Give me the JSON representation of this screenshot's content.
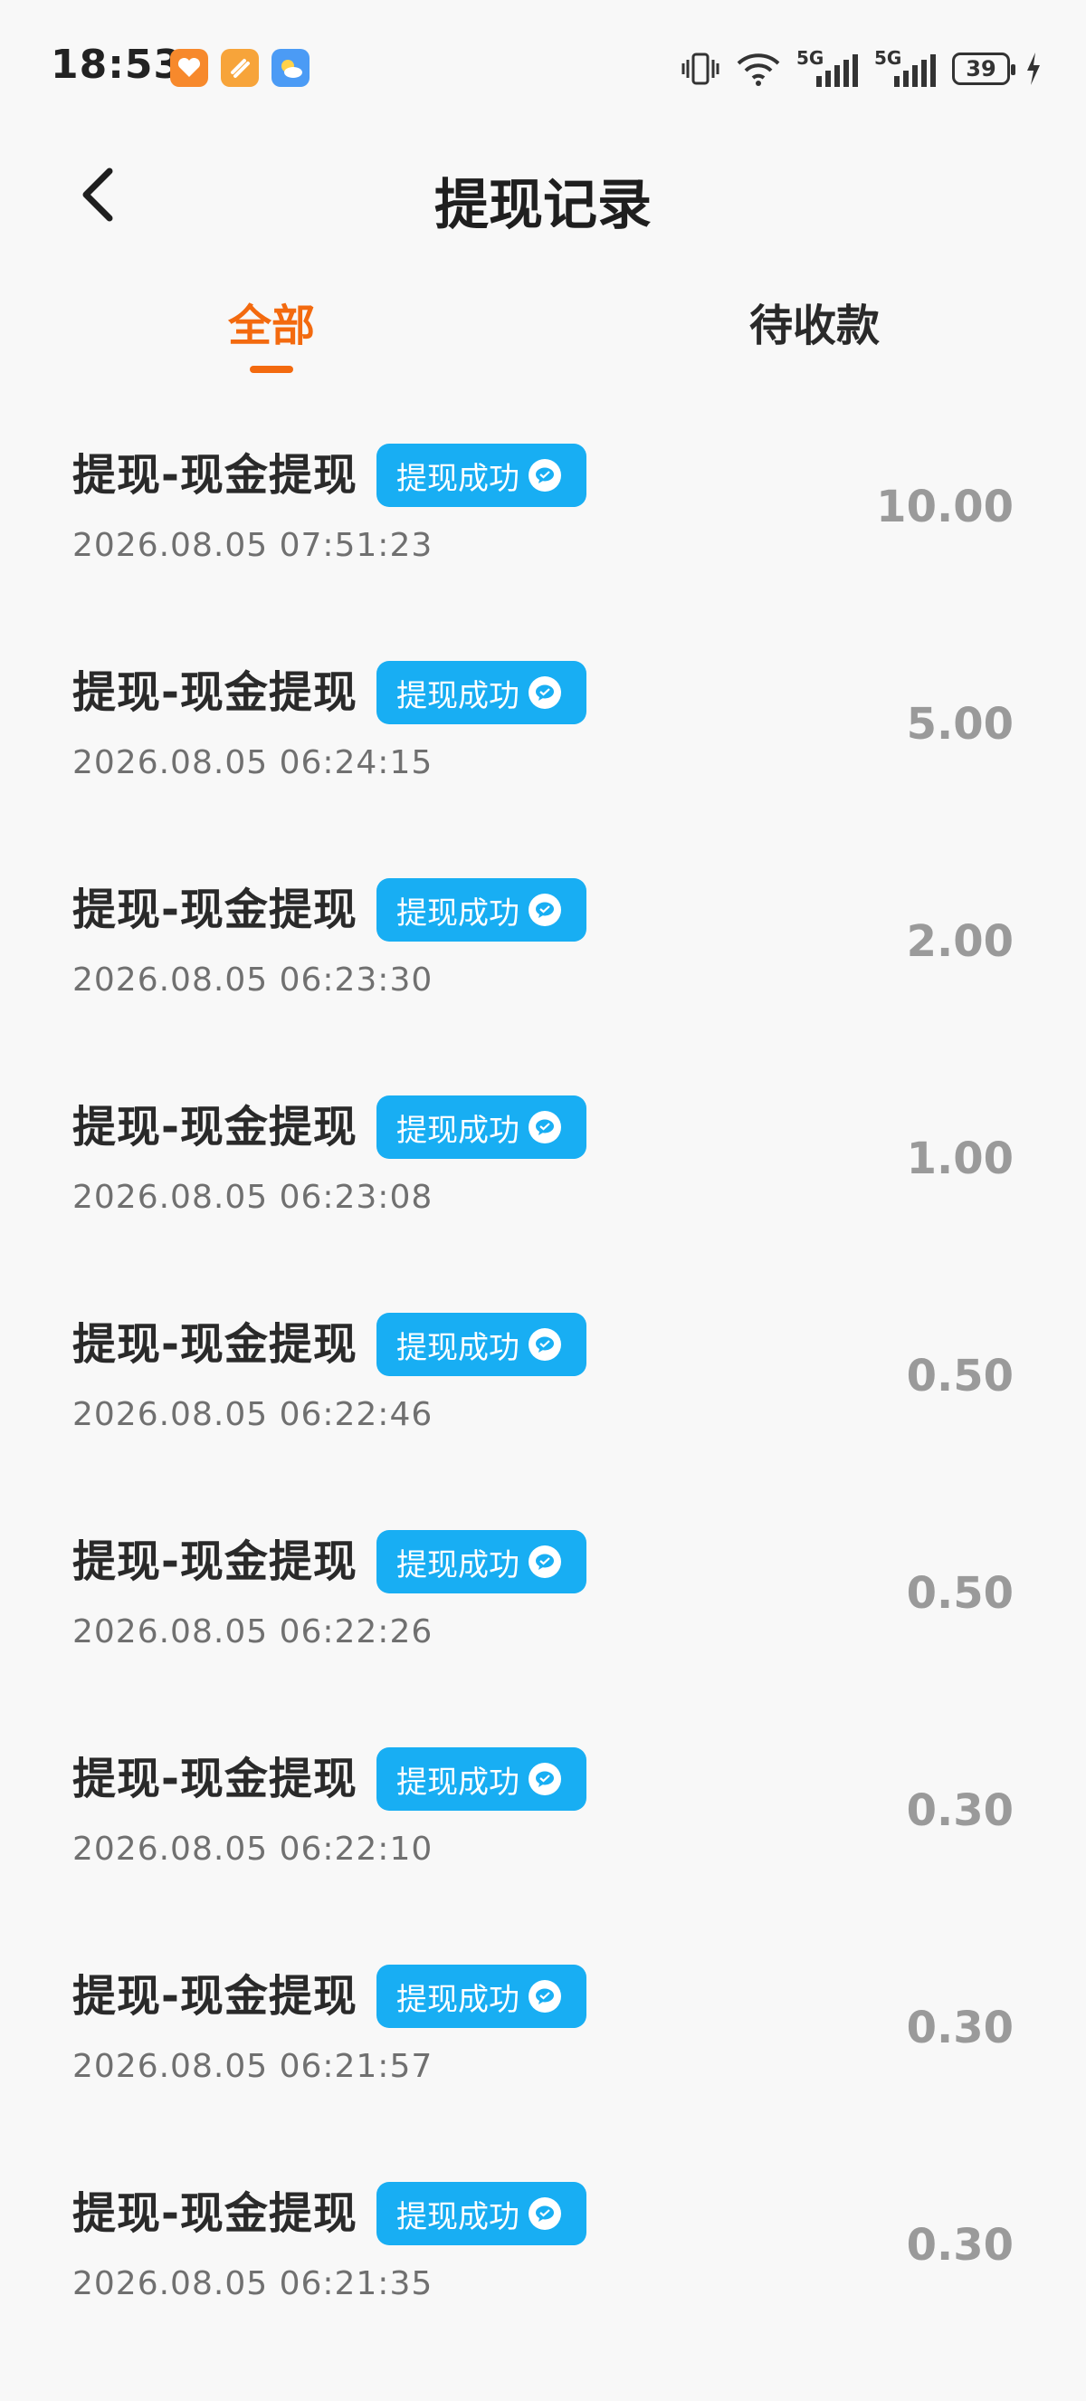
{
  "status_bar": {
    "time": "18:53",
    "battery": "39",
    "signal1_label": "5G",
    "signal2_label": "5G"
  },
  "header": {
    "title": "提现记录"
  },
  "tabs": [
    {
      "label": "全部",
      "active": true
    },
    {
      "label": "待收款",
      "active": false
    }
  ],
  "records": [
    {
      "title": "提现-现金提现",
      "status": "提现成功",
      "time": "2026.08.05 07:51:23",
      "amount": "10.00"
    },
    {
      "title": "提现-现金提现",
      "status": "提现成功",
      "time": "2026.08.05 06:24:15",
      "amount": "5.00"
    },
    {
      "title": "提现-现金提现",
      "status": "提现成功",
      "time": "2026.08.05 06:23:30",
      "amount": "2.00"
    },
    {
      "title": "提现-现金提现",
      "status": "提现成功",
      "time": "2026.08.05 06:23:08",
      "amount": "1.00"
    },
    {
      "title": "提现-现金提现",
      "status": "提现成功",
      "time": "2026.08.05 06:22:46",
      "amount": "0.50"
    },
    {
      "title": "提现-现金提现",
      "status": "提现成功",
      "time": "2026.08.05 06:22:26",
      "amount": "0.50"
    },
    {
      "title": "提现-现金提现",
      "status": "提现成功",
      "time": "2026.08.05 06:22:10",
      "amount": "0.30"
    },
    {
      "title": "提现-现金提现",
      "status": "提现成功",
      "time": "2026.08.05 06:21:57",
      "amount": "0.30"
    },
    {
      "title": "提现-现金提现",
      "status": "提现成功",
      "time": "2026.08.05 06:21:35",
      "amount": "0.30"
    }
  ],
  "colors": {
    "accent": "#f36a0f",
    "badge": "#18aef3",
    "amount": "#9a9a9a"
  },
  "icons": {
    "back": "chevron-left-icon",
    "badge": "wechat-icon"
  }
}
